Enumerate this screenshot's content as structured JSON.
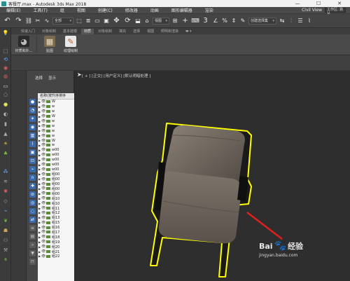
{
  "titlebar": {
    "title": "客餐厅.max - Autodesk 3ds Max 2018",
    "minimize": "—",
    "maximize": "☐",
    "close": "✕"
  },
  "menubar": {
    "items": [
      "编辑(E)",
      "工具(T)",
      "组",
      "视图",
      "创建(C)",
      "修改器",
      "动画",
      "图形编辑器",
      "渲染"
    ],
    "workspace_label": "Civil View",
    "workspace_value": "工作区: 默认"
  },
  "toolbar": {
    "filter_value": "全部",
    "view_value": "视图",
    "selset_value": "创建选择集"
  },
  "ribbon": {
    "tabs": [
      "快速入门",
      "对象绘制",
      "基本建模",
      "材质",
      "对象绘制",
      "填充",
      "选择",
      "视图",
      "照明和渲染"
    ],
    "active_tab": "材质",
    "buttons": [
      {
        "label": "材质和外...",
        "icon": "material-sphere-icon"
      },
      {
        "label": "贴图",
        "icon": "map-icon"
      },
      {
        "label": "纹理绘制",
        "icon": "texture-paint-icon"
      }
    ]
  },
  "scene_explorer": {
    "tabs": [
      "选择",
      "显示"
    ],
    "header": "名称(按升序排序",
    "rows": [
      "W",
      "w",
      "w",
      "W",
      "w",
      "w",
      "w",
      "w",
      "W",
      "w",
      "w00",
      "w00",
      "w00",
      "w00",
      "w00",
      "组00",
      "组00",
      "组00",
      "组00",
      "组00",
      "组10",
      "组10",
      "组11",
      "组12",
      "组13",
      "组15",
      "组16",
      "组17",
      "组18",
      "组19",
      "组20",
      "组21",
      "组22"
    ]
  },
  "viewport": {
    "label": "[ + ] [正交] [用户定义] [默认明暗处理 ]"
  },
  "watermark": {
    "brand_text": "经验",
    "url": "jingyan.baidu.com",
    "bai": "Bai"
  },
  "colors": {
    "selection_outline": "#ffff00",
    "chair_fabric": "#6e655d",
    "arrow": "#e02020"
  }
}
